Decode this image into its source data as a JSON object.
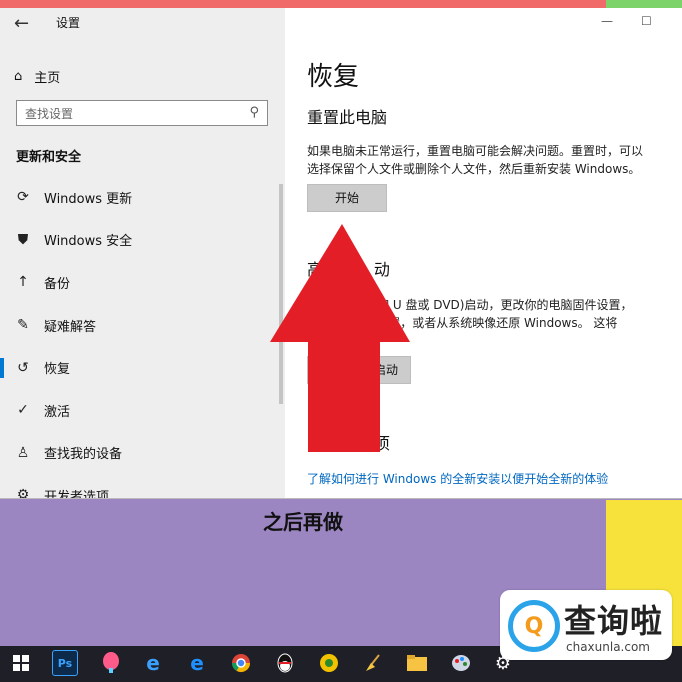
{
  "window": {
    "app_title": "设置",
    "minimize": "—",
    "maximize": "☐"
  },
  "sidebar": {
    "home_label": "主页",
    "search_placeholder": "查找设置",
    "section_title": "更新和安全",
    "items": [
      {
        "label": "Windows 更新",
        "icon": "refresh-icon"
      },
      {
        "label": "Windows 安全",
        "icon": "shield-icon"
      },
      {
        "label": "备份",
        "icon": "upload-arrow-icon"
      },
      {
        "label": "疑难解答",
        "icon": "wrench-icon"
      },
      {
        "label": "恢复",
        "icon": "history-icon",
        "active": true
      },
      {
        "label": "激活",
        "icon": "check-circle-icon"
      },
      {
        "label": "查找我的设备",
        "icon": "person-location-icon"
      },
      {
        "label": "开发者选项",
        "icon": "developer-icon"
      }
    ]
  },
  "main": {
    "page_title": "恢复",
    "reset": {
      "heading": "重置此电脑",
      "desc_line1": "如果电脑未正常运行，重置电脑可能会解决问题。重置时，可以",
      "desc_line2": "选择保留个人文件或删除个人文件，然后重新安装 Windows。",
      "button": "开始"
    },
    "advanced": {
      "heading": "高          动",
      "desc_line1": "              设(如 U 盘或 DVD)启动，更改你的电脑固件设置，",
      "desc_line2": "               动设置，或者从系统映像还原 Windows。 这将",
      "button": "启动"
    },
    "more": {
      "heading": "          选项",
      "link": "了解如何进行 Windows 的全新安装以便开始全新的体验"
    }
  },
  "desktop": {
    "caption": "之后再做"
  },
  "taskbar": {
    "ps_label": "Ps"
  },
  "watermark": {
    "brand": "查询啦",
    "domain": "chaxunla.com",
    "logo_glyph": "Q"
  },
  "colors": {
    "accent": "#0078d4",
    "link": "#0067c0",
    "arrow": "#e41e26",
    "desktop": "#9b86c2"
  }
}
